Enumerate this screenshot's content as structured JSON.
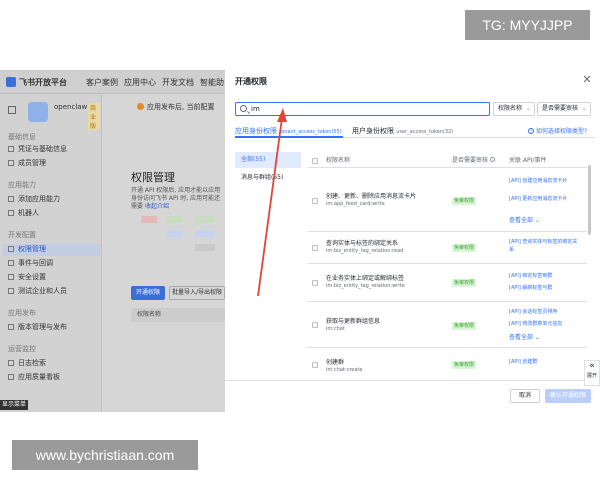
{
  "watermarks": {
    "top": "TG: MYYJJPP",
    "bottom": "www.bychristiaan.com"
  },
  "background_app": {
    "topbar": {
      "brand": "飞书开放平台",
      "nav": [
        "客户案例",
        "应用中心",
        "开发文档",
        "智能助"
      ]
    },
    "app": {
      "name": "openclaw",
      "badge": "商业版"
    },
    "alert_text": "应用发布后, 当前配置",
    "sidebar": {
      "sections": [
        {
          "title": "基础信息",
          "items": [
            "凭证与基础信息",
            "成员管理"
          ]
        },
        {
          "title": "应用能力",
          "items": [
            "添加应用能力",
            "机器人"
          ]
        },
        {
          "title": "开发配置",
          "items": [
            "权限管理",
            "事件与回调",
            "安全设置",
            "测试企业和人员"
          ]
        },
        {
          "title": "应用发布",
          "items": [
            "版本管理与发布"
          ]
        },
        {
          "title": "运营监控",
          "items": [
            "日志检索",
            "应用质量看板"
          ]
        }
      ],
      "active_item": "权限管理"
    },
    "main": {
      "title": "权限管理",
      "desc": "开通 API 权限后, 应用才能以应用身份访问飞书 API 时, 应用可能还需要",
      "link": "收起介绍",
      "btn_primary": "开通权限",
      "btn_secondary": "批量导入/导出权限",
      "table_header": "权限名称"
    },
    "tooltip": "显示菜单"
  },
  "modal": {
    "title": "开通权限",
    "search": {
      "value": "im"
    },
    "filters": [
      "权限名称",
      "是否需要审核"
    ],
    "tabs": [
      {
        "label": "应用身份权限",
        "sub": "tenant_access_token(55)"
      },
      {
        "label": "用户身份权限",
        "sub": "user_access_token(32)"
      }
    ],
    "help_link": "如何选择权限类型?",
    "categories": [
      "全部(55)",
      "消息与群组(55)"
    ],
    "table": {
      "headers": [
        "权限名称",
        "是否需要审核",
        "关联 API/事件"
      ],
      "rows": [
        {
          "name": "创建、更新、删除应用消息流卡片",
          "scope": "im:app_feed_card:write",
          "badge": "免审权限",
          "events": [
            "[API] 创建应用消息流卡片",
            "[API] 更新应用消息流卡片"
          ],
          "more": "查看全部"
        },
        {
          "name": "查询实体与标签的绑定关系",
          "scope": "im:biz_entity_tag_relation:read",
          "badge": "免审权限",
          "events": [
            "[API] 查询实体与标签的绑定关系"
          ],
          "more": ""
        },
        {
          "name": "在业务实体上绑定或解绑标签",
          "scope": "im:biz_entity_tag_relation:write",
          "badge": "免审权限",
          "events": [
            "[API] 绑定标签到群",
            "[API] 解绑标签与群"
          ],
          "more": ""
        },
        {
          "name": "获取与更新群组信息",
          "scope": "im:chat",
          "badge": "免审权限",
          "events": [
            "[API] 会话标签页排序",
            "[API] 修改群菜单元信息"
          ],
          "more": "查看全部"
        },
        {
          "name": "创建群",
          "scope": "im:chat:create",
          "badge": "免审权限",
          "events": [
            "[API] 创建群"
          ],
          "more": ""
        }
      ]
    },
    "footer": {
      "cancel": "取消",
      "confirm": "确认开通权限"
    },
    "expand_label": "展开"
  },
  "colors": {
    "accent": "#3370ff",
    "badge_bg": "#d9f5d6",
    "badge_text": "#2ea121",
    "annotation_arrow": "#e0443a"
  },
  "icons": [
    "search-icon",
    "close-icon",
    "chevron-down-icon",
    "help-icon",
    "info-icon",
    "expand-icon",
    "home-icon"
  ]
}
